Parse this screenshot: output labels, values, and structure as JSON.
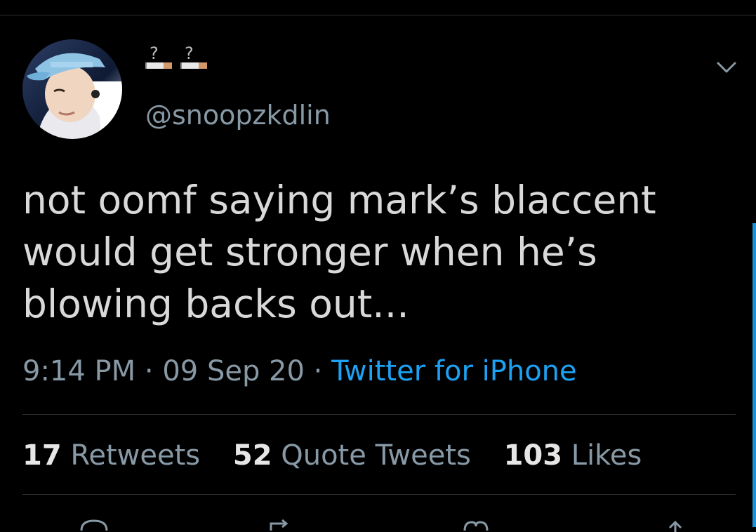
{
  "tweet": {
    "user": {
      "display_name_icons": [
        "cigarette-icon",
        "cigarette-icon"
      ],
      "handle": "@snoopzkdlin"
    },
    "text": "not oomf saying mark’s blaccent\nwould get stronger when he’s\nblowing backs out...",
    "time": "9:14 PM",
    "separator": " · ",
    "date": "09 Sep 20",
    "source": "Twitter for iPhone",
    "stats": {
      "retweets_count": "17",
      "retweets_label": "Retweets",
      "quotes_count": "52",
      "quotes_label": "Quote Tweets",
      "likes_count": "103",
      "likes_label": "Likes"
    }
  },
  "colors": {
    "background": "#000000",
    "text": "#d9d9d9",
    "muted": "#8899a6",
    "link": "#1da1f2",
    "divider": "#2a2d30"
  }
}
